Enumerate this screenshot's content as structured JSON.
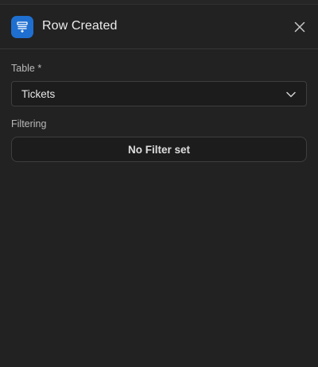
{
  "header": {
    "title": "Row Created",
    "icon": "table-row-icon",
    "icon_color": "#1f6fd0",
    "close_icon": "close-icon"
  },
  "form": {
    "table_label": "Table *",
    "table_value": "Tickets",
    "filtering_label": "Filtering",
    "filter_button_label": "No Filter set"
  }
}
